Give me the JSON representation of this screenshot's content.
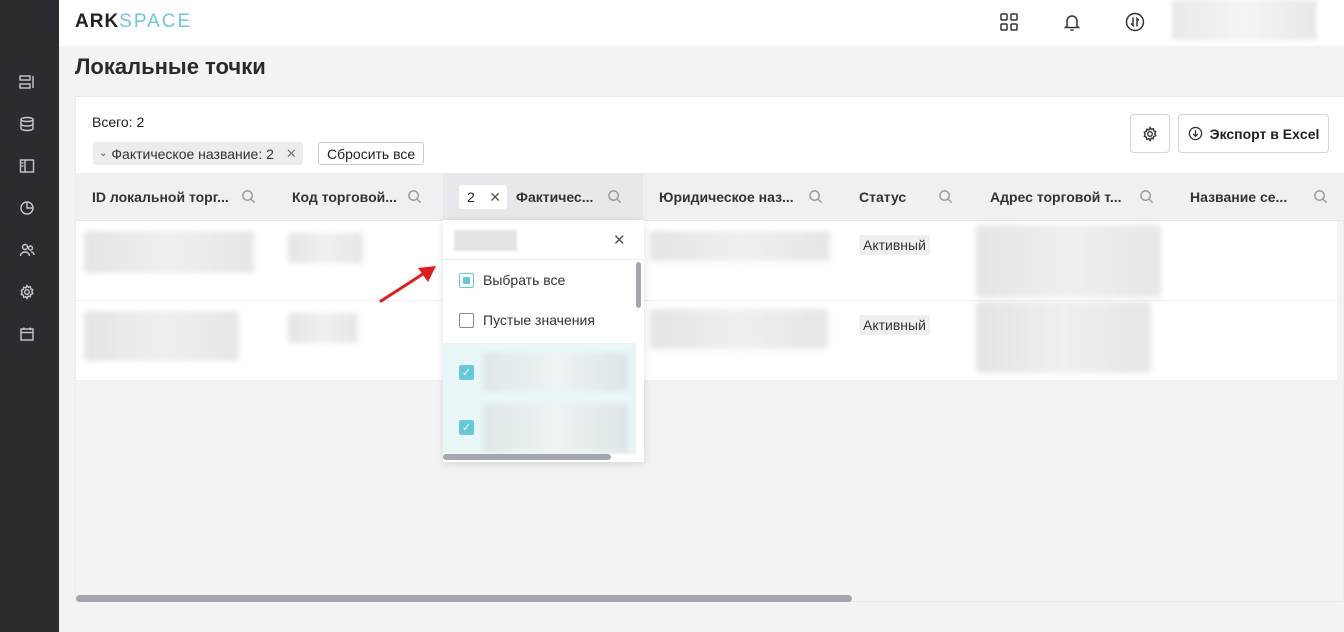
{
  "logo": {
    "ark": "ARK",
    "space": "SPACE"
  },
  "page_title": "Локальные точки",
  "toolbar": {
    "total": "Всего: 2",
    "filter_chip": "Фактическое название: 2",
    "reset_label": "Сбросить все",
    "export_label": "Экспорт в Excel"
  },
  "columns": [
    "ID локальной торг...",
    "Код торговой...",
    "Фактичес...",
    "Юридическое наз...",
    "Статус",
    "Адрес торговой т...",
    "Название се..."
  ],
  "active_filter_count": "2",
  "rows": [
    {
      "status": "Активный"
    },
    {
      "status": "Активный"
    }
  ],
  "dropdown": {
    "select_all": "Выбрать все",
    "empty_values": "Пустые значения"
  },
  "icons": {
    "sidebar": [
      "list-icon",
      "database-icon",
      "sidebar-panel-icon",
      "pie-chart-icon",
      "users-icon",
      "gear-icon",
      "calendar-icon"
    ],
    "header": [
      "apps-grid-icon",
      "bell-icon",
      "exchange-icon"
    ]
  },
  "colors": {
    "accent": "#66c9d9",
    "sidebar": "#2b2b30",
    "arrow": "#e01e1e"
  }
}
